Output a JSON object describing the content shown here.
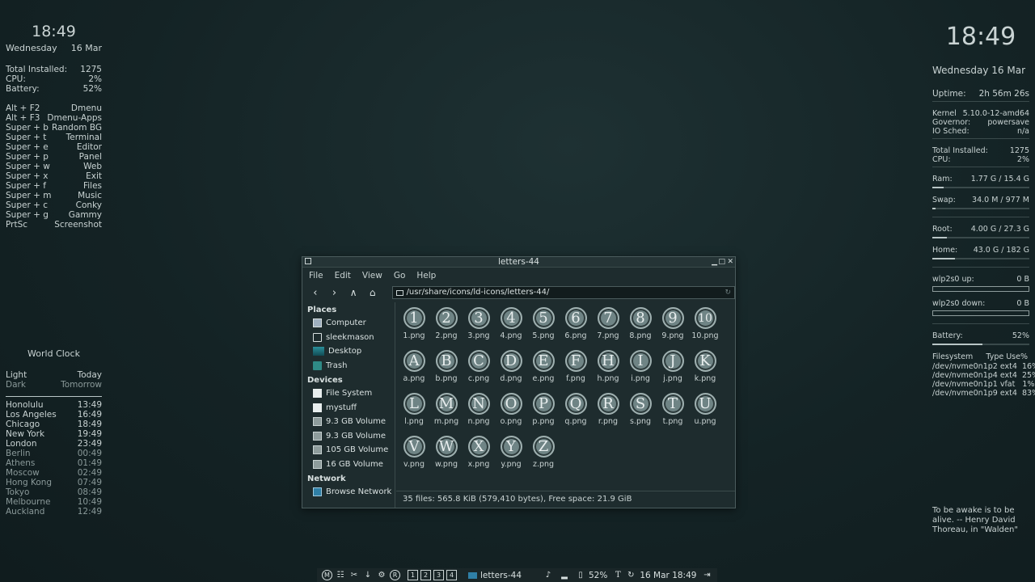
{
  "left_conky": {
    "time": "18:49",
    "day": "Wednesday",
    "date": "16 Mar",
    "stats": [
      {
        "label": "Total Installed:",
        "value": "1275"
      },
      {
        "label": "CPU:",
        "value": "2%"
      },
      {
        "label": "Battery:",
        "value": "52%"
      }
    ],
    "shortcuts": [
      {
        "key": "Alt + F2",
        "action": "Dmenu"
      },
      {
        "key": "Alt + F3",
        "action": "Dmenu-Apps"
      },
      {
        "key": "Super + b",
        "action": "Random BG"
      },
      {
        "key": "Super + t",
        "action": "Terminal"
      },
      {
        "key": "Super + e",
        "action": "Editor"
      },
      {
        "key": "Super + p",
        "action": "Panel"
      },
      {
        "key": "Super + w",
        "action": "Web"
      },
      {
        "key": "Super + x",
        "action": "Exit"
      },
      {
        "key": "Super + f",
        "action": "Files"
      },
      {
        "key": "Super + m",
        "action": "Music"
      },
      {
        "key": "Super + c",
        "action": "Conky"
      },
      {
        "key": "Super + g",
        "action": "Gammy"
      },
      {
        "key": "PrtSc",
        "action": "Screenshot"
      }
    ]
  },
  "world_clock": {
    "title": "World Clock",
    "legend": [
      {
        "left": "Light",
        "right": "Today"
      },
      {
        "left": "Dark",
        "right": "Tomorrow"
      }
    ],
    "cities": [
      {
        "city": "Honolulu",
        "time": "13:49",
        "light": true
      },
      {
        "city": "Los Angeles",
        "time": "16:49",
        "light": true
      },
      {
        "city": "Chicago",
        "time": "18:49",
        "light": true
      },
      {
        "city": "New York",
        "time": "19:49",
        "light": true
      },
      {
        "city": "London",
        "time": "23:49",
        "light": true
      },
      {
        "city": "Berlin",
        "time": "00:49",
        "light": false
      },
      {
        "city": "Athens",
        "time": "01:49",
        "light": false
      },
      {
        "city": "Moscow",
        "time": "02:49",
        "light": false
      },
      {
        "city": "Hong Kong",
        "time": "07:49",
        "light": false
      },
      {
        "city": "Tokyo",
        "time": "08:49",
        "light": false
      },
      {
        "city": "Melbourne",
        "time": "10:49",
        "light": false
      },
      {
        "city": "Auckland",
        "time": "12:49",
        "light": false
      }
    ]
  },
  "right_conky": {
    "time": "18:49",
    "date": "Wednesday 16 Mar",
    "uptime_label": "Uptime:",
    "uptime": "2h 56m 26s",
    "sys": [
      {
        "label": "Kernel",
        "value": "5.10.0-12-amd64"
      },
      {
        "label": "Governor:",
        "value": "powersave"
      },
      {
        "label": "IO Sched:",
        "value": "n/a"
      }
    ],
    "stats": [
      {
        "label": "Total Installed:",
        "value": "1275"
      },
      {
        "label": "CPU:",
        "value": "2%"
      }
    ],
    "ram": {
      "label": "Ram:",
      "value": "1.77 G  / 15.4 G",
      "fraction": 0.115
    },
    "swap": {
      "label": "Swap:",
      "value": "34.0 M  / 977 M",
      "fraction": 0.035
    },
    "root": {
      "label": "Root:",
      "value": "4.00 G / 27.3 G",
      "fraction": 0.146
    },
    "home": {
      "label": "Home:",
      "value": "43.0 G / 182 G",
      "fraction": 0.236
    },
    "net_up": {
      "label": "wlp2s0 up:",
      "value": "0 B"
    },
    "net_down": {
      "label": "wlp2s0 down:",
      "value": "0 B"
    },
    "battery": {
      "label": "Battery:",
      "value": "52%",
      "fraction": 0.52
    },
    "fs_header": {
      "left": "Filesystem",
      "right": "Type Use%"
    },
    "fs": [
      "/dev/nvme0n1p2 ext4  16%",
      "/dev/nvme0n1p4 ext4  25%",
      "/dev/nvme0n1p1 vfat   1%",
      "/dev/nvme0n1p9 ext4  83%"
    ],
    "quote_lines": [
      "To be awake is to be",
      "alive.  -- Henry David",
      "Thoreau, in \"Walden\""
    ]
  },
  "file_manager": {
    "title": "letters-44",
    "menu": [
      "File",
      "Edit",
      "View",
      "Go",
      "Help"
    ],
    "path": "/usr/share/icons/ld-icons/letters-44/",
    "places_header": "Places",
    "places": [
      {
        "label": "Computer",
        "icon": "computer-icon"
      },
      {
        "label": "sleekmason",
        "icon": "home-icon"
      },
      {
        "label": "Desktop",
        "icon": "desktop-icon"
      },
      {
        "label": "Trash",
        "icon": "trash-icon"
      }
    ],
    "devices_header": "Devices",
    "devices": [
      {
        "label": "File System",
        "icon": "drive-icon"
      },
      {
        "label": "mystuff",
        "icon": "drive-icon"
      },
      {
        "label": "9.3 GB Volume",
        "icon": "volume-icon"
      },
      {
        "label": "9.3 GB Volume",
        "icon": "volume-icon"
      },
      {
        "label": "105 GB Volume",
        "icon": "volume-icon"
      },
      {
        "label": "16 GB Volume",
        "icon": "volume-icon"
      }
    ],
    "network_header": "Network",
    "network": [
      {
        "label": "Browse Network",
        "icon": "network-icon"
      }
    ],
    "files": [
      {
        "glyph": "1",
        "name": "1.png"
      },
      {
        "glyph": "2",
        "name": "2.png"
      },
      {
        "glyph": "3",
        "name": "3.png"
      },
      {
        "glyph": "4",
        "name": "4.png"
      },
      {
        "glyph": "5",
        "name": "5.png"
      },
      {
        "glyph": "6",
        "name": "6.png"
      },
      {
        "glyph": "7",
        "name": "7.png"
      },
      {
        "glyph": "8",
        "name": "8.png"
      },
      {
        "glyph": "9",
        "name": "9.png"
      },
      {
        "glyph": "10",
        "name": "10.png"
      },
      {
        "glyph": "A",
        "name": "a.png"
      },
      {
        "glyph": "B",
        "name": "b.png"
      },
      {
        "glyph": "C",
        "name": "c.png"
      },
      {
        "glyph": "D",
        "name": "d.png"
      },
      {
        "glyph": "E",
        "name": "e.png"
      },
      {
        "glyph": "F",
        "name": "f.png"
      },
      {
        "glyph": "H",
        "name": "h.png"
      },
      {
        "glyph": "I",
        "name": "i.png"
      },
      {
        "glyph": "J",
        "name": "j.png"
      },
      {
        "glyph": "K",
        "name": "k.png"
      },
      {
        "glyph": "L",
        "name": "l.png"
      },
      {
        "glyph": "M",
        "name": "m.png"
      },
      {
        "glyph": "N",
        "name": "n.png"
      },
      {
        "glyph": "O",
        "name": "o.png"
      },
      {
        "glyph": "P",
        "name": "p.png"
      },
      {
        "glyph": "Q",
        "name": "q.png"
      },
      {
        "glyph": "R",
        "name": "r.png"
      },
      {
        "glyph": "S",
        "name": "s.png"
      },
      {
        "glyph": "T",
        "name": "t.png"
      },
      {
        "glyph": "U",
        "name": "u.png"
      },
      {
        "glyph": "V",
        "name": "v.png"
      },
      {
        "glyph": "W",
        "name": "w.png"
      },
      {
        "glyph": "X",
        "name": "x.png"
      },
      {
        "glyph": "Y",
        "name": "y.png"
      },
      {
        "glyph": "Z",
        "name": "z.png"
      }
    ],
    "status": "35 files: 565.8 KiB (579,410 bytes), Free space: 21.9 GiB"
  },
  "taskbar": {
    "workspaces": [
      "1",
      "2",
      "3",
      "4"
    ],
    "task_label": "letters-44",
    "battery": "52%",
    "clock": "16 Mar 18:49"
  }
}
